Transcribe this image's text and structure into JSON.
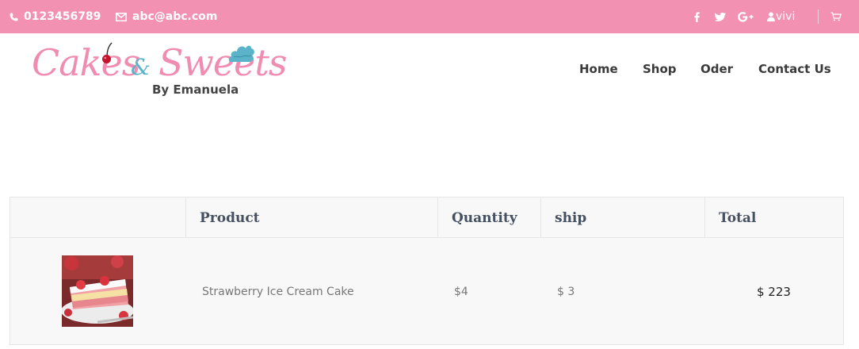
{
  "topbar": {
    "phone": "0123456789",
    "email": "abc@abc.com",
    "user": "vivi",
    "icons": [
      "phone-icon",
      "envelope-icon",
      "facebook-icon",
      "twitter-icon",
      "google-plus-icon",
      "user-icon",
      "cart-icon"
    ],
    "background": "#f291b2"
  },
  "logo": {
    "word1": "Cakes",
    "ampersand": "&",
    "word2": "Sweets",
    "byline": "By Emanuela"
  },
  "nav": {
    "items": [
      "Home",
      "Shop",
      "Oder",
      "Contact Us"
    ]
  },
  "table": {
    "headers": {
      "product": "Product",
      "quantity": "Quantity",
      "ship": "ship",
      "total": "Total"
    },
    "rows": [
      {
        "product": "Strawberry Ice Cream Cake",
        "quantity": "$4",
        "ship": "$ 3",
        "total": "$ 223"
      }
    ]
  }
}
